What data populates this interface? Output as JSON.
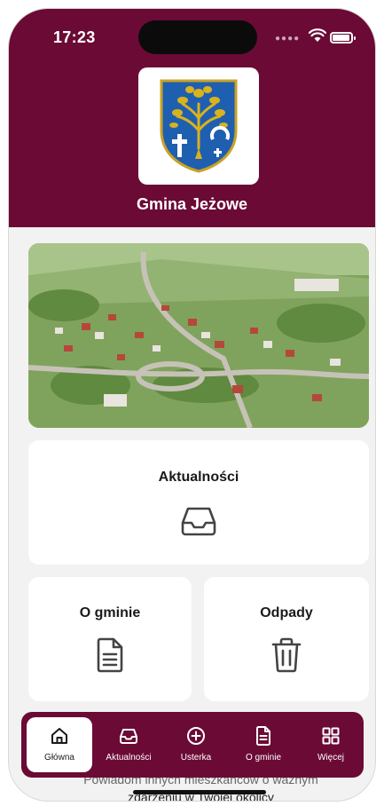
{
  "status_bar": {
    "time": "17:23"
  },
  "header": {
    "town_name": "Gmina Jeżowe",
    "logo_icon": "coat-of-arms-icon"
  },
  "hero": {
    "image_icon": "aerial-town-photo"
  },
  "cards": {
    "news": {
      "title": "Aktualności",
      "icon": "inbox-icon"
    },
    "gmina": {
      "title": "O gminie",
      "icon": "document-icon"
    },
    "odpady": {
      "title": "Odpady",
      "icon": "trash-icon"
    }
  },
  "partial_text": {
    "line1": "Powiadom innych mieszkańców o ważnym",
    "line2": "zdarzeniu w Twojej okolicy"
  },
  "tabbar": {
    "items": [
      {
        "label": "Główna",
        "icon": "home-icon",
        "active": true
      },
      {
        "label": "Aktualności",
        "icon": "inbox-icon",
        "active": false
      },
      {
        "label": "Usterka",
        "icon": "plus-circle-icon",
        "active": false
      },
      {
        "label": "O gminie",
        "icon": "document-icon",
        "active": false
      },
      {
        "label": "Więcej",
        "icon": "grid-icon",
        "active": false
      }
    ]
  },
  "colors": {
    "brand": "#6b0a35",
    "background": "#f2f2f3",
    "card": "#ffffff",
    "text": "#1a1a1a"
  }
}
